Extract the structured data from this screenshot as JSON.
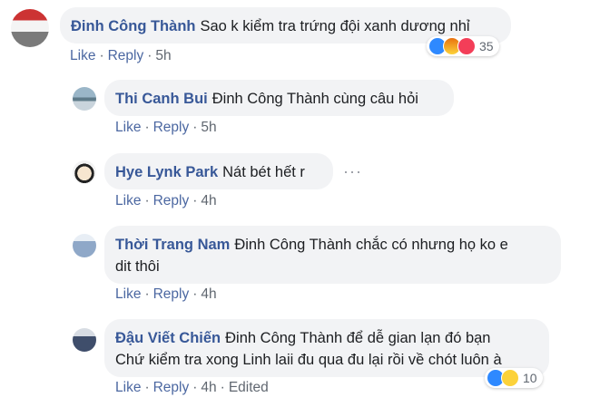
{
  "actions": {
    "like": "Like",
    "reply": "Reply",
    "edited": "Edited"
  },
  "comments": [
    {
      "author": "Đinh Công Thành",
      "text": "Sao k kiểm tra trứng đội xanh dương nhỉ",
      "time": "5h",
      "reaction_count": "35"
    },
    {
      "author": "Thi Canh Bui",
      "text": "Đinh Công Thành cùng câu hỏi",
      "time": "5h"
    },
    {
      "author": "Hye Lynk Park",
      "text": "Nát bét hết r",
      "time": "4h"
    },
    {
      "author": "Thời Trang Nam",
      "text_line1": "Đinh Công Thành chắc có nhưng họ ko e",
      "text_line2": "dit thôi",
      "time": "4h"
    },
    {
      "author": "Đậu Viết Chiến",
      "text_line1": "Đinh Công Thành để dễ gian lạn đó bạn",
      "text_line2": "Chứ kiểm tra xong Linh laii đu qua đu lại rồi về chót luôn à",
      "time": "4h",
      "reaction_count": "10"
    }
  ]
}
